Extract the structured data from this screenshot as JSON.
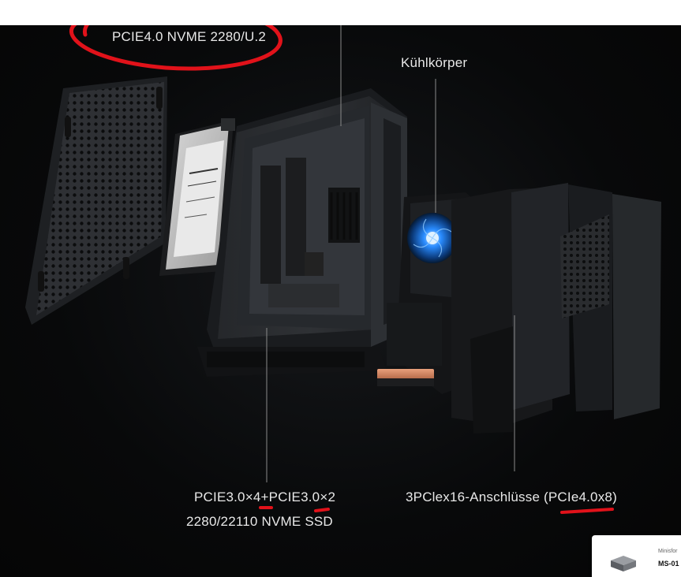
{
  "labels": {
    "pcie_u2": "PCIE4.0 NVME 2280/U.2",
    "heatsink": "Kühlkörper",
    "nvme_line1": "PCIE3.0×4+PCIE3.0×2",
    "nvme_line2": "2280/22110 NVME SSD",
    "pcie_slot": "3PClex16-Anschlüsse (PCIe4.0x8)"
  },
  "thumbnail": {
    "brand": "Minisfor",
    "model": "MS-01"
  },
  "colors": {
    "annotation_red": "#e1121a",
    "label_text": "#e8e8e8",
    "background": "#070809",
    "fan_blue": "#2a8cff"
  }
}
